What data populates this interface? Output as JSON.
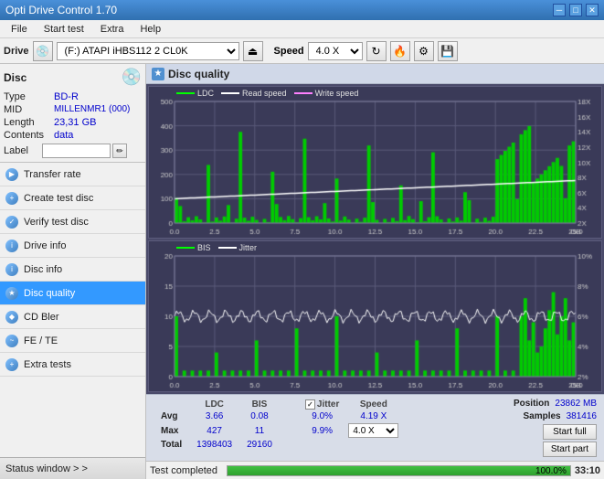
{
  "titlebar": {
    "title": "Opti Drive Control 1.70",
    "minimize_label": "─",
    "maximize_label": "□",
    "close_label": "✕"
  },
  "menubar": {
    "items": [
      {
        "label": "File"
      },
      {
        "label": "Start test"
      },
      {
        "label": "Extra"
      },
      {
        "label": "Help"
      }
    ]
  },
  "toolbar": {
    "drive_label": "Drive",
    "drive_value": "(F:)  ATAPI iHBS112  2 CL0K",
    "speed_label": "Speed",
    "speed_value": "4.0 X"
  },
  "disc": {
    "section_title": "Disc",
    "type_label": "Type",
    "type_value": "BD-R",
    "mid_label": "MID",
    "mid_value": "MILLENMR1 (000)",
    "length_label": "Length",
    "length_value": "23,31 GB",
    "contents_label": "Contents",
    "contents_value": "data",
    "label_label": "Label",
    "label_value": ""
  },
  "nav": {
    "items": [
      {
        "id": "transfer-rate",
        "label": "Transfer rate",
        "active": false
      },
      {
        "id": "create-test-disc",
        "label": "Create test disc",
        "active": false
      },
      {
        "id": "verify-test-disc",
        "label": "Verify test disc",
        "active": false
      },
      {
        "id": "drive-info",
        "label": "Drive info",
        "active": false
      },
      {
        "id": "disc-info",
        "label": "Disc info",
        "active": false
      },
      {
        "id": "disc-quality",
        "label": "Disc quality",
        "active": true
      },
      {
        "id": "cd-bler",
        "label": "CD Bler",
        "active": false
      },
      {
        "id": "fe-te",
        "label": "FE / TE",
        "active": false
      },
      {
        "id": "extra-tests",
        "label": "Extra tests",
        "active": false
      }
    ]
  },
  "status_window": {
    "label": "Status window > >"
  },
  "disc_quality": {
    "title": "Disc quality",
    "legend_ldc": "LDC",
    "legend_read": "Read speed",
    "legend_write": "Write speed",
    "legend_bis": "BIS",
    "legend_jitter": "Jitter",
    "x_max": "25.0",
    "x_unit": "GB",
    "chart1_y_max": "500",
    "chart1_y_labels": [
      "500",
      "400",
      "300",
      "200",
      "100"
    ],
    "chart1_y_right": [
      "18X",
      "16X",
      "14X",
      "12X",
      "10X",
      "8X",
      "6X",
      "4X",
      "2X"
    ],
    "chart2_y_max": "20",
    "chart2_y_labels": [
      "20",
      "15",
      "10",
      "5"
    ],
    "chart2_y_right": [
      "10%",
      "8%",
      "6%",
      "4%",
      "2%"
    ]
  },
  "stats": {
    "col_ldc": "LDC",
    "col_bis": "BIS",
    "col_jitter": "Jitter",
    "col_speed": "Speed",
    "row_avg": "Avg",
    "row_max": "Max",
    "row_total": "Total",
    "avg_ldc": "3.66",
    "avg_bis": "0.08",
    "avg_jitter": "9.0%",
    "avg_speed": "4.19 X",
    "max_ldc": "427",
    "max_bis": "11",
    "max_jitter": "9.9%",
    "total_ldc": "1398403",
    "total_bis": "29160",
    "speed_select_value": "4.0 X",
    "position_label": "Position",
    "position_value": "23862 MB",
    "samples_label": "Samples",
    "samples_value": "381416",
    "start_full_label": "Start full",
    "start_part_label": "Start part",
    "jitter_checked": true,
    "jitter_label": "Jitter"
  },
  "progressbar": {
    "status_text": "Test completed",
    "progress_pct": "100.0%",
    "progress_fill": 100,
    "time_display": "33:10"
  },
  "colors": {
    "ldc": "#00ff00",
    "read_speed": "#ffffff",
    "write_speed": "#ff80ff",
    "bis": "#00ff00",
    "jitter": "#ffffff",
    "chart_bg": "#3a3a5a",
    "grid": "#5a5a7a",
    "accent_blue": "#3399ff"
  }
}
